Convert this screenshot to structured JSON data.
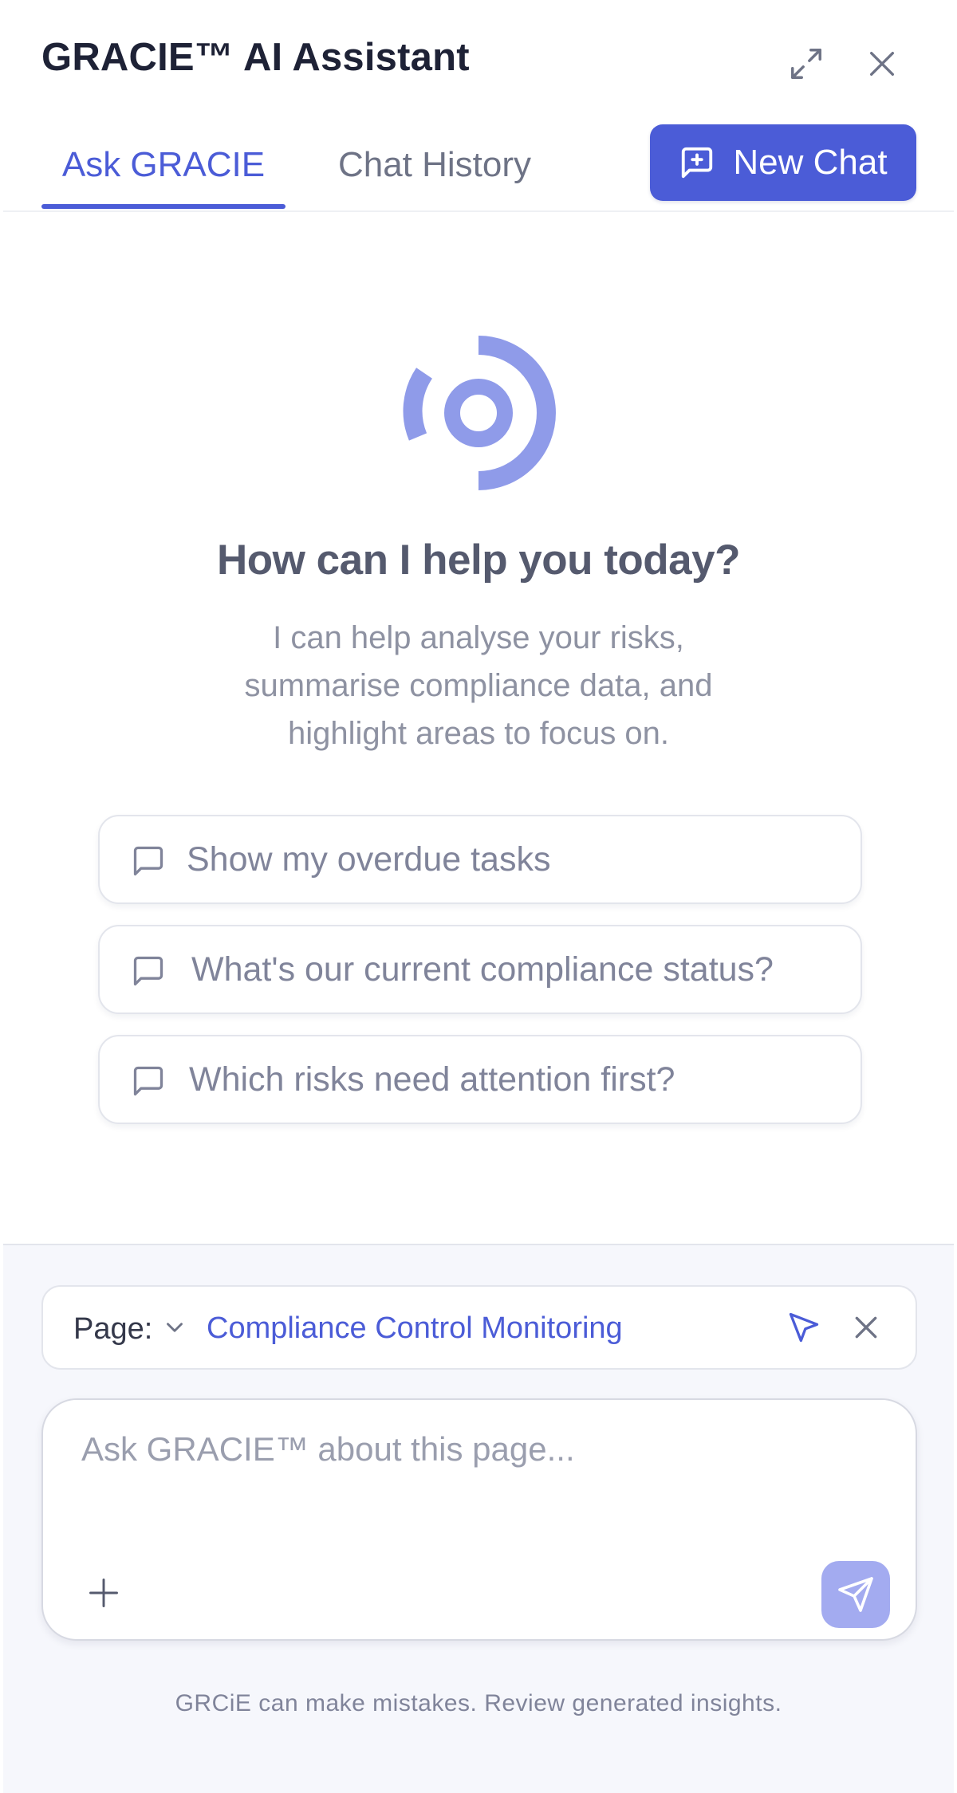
{
  "header": {
    "title": "GRACIE™ AI Assistant",
    "expand_icon": "expand-icon",
    "close_icon": "close-icon"
  },
  "tabs": [
    {
      "label": "Ask GRACIE",
      "active": true
    },
    {
      "label": "Chat History",
      "active": false
    }
  ],
  "new_chat": {
    "label": "New Chat",
    "icon": "message-plus-icon"
  },
  "hero": {
    "logo_icon": "gracie-logo-icon",
    "headline": "How can I help you today?",
    "subtext": "I can help analyse your risks, summarise compliance data, and highlight areas to focus on."
  },
  "suggestions": [
    {
      "label": "Show my overdue tasks",
      "icon": "message-square-icon"
    },
    {
      "label": "What's our current compliance status?",
      "icon": "message-square-icon"
    },
    {
      "label": "Which risks need attention first?",
      "icon": "message-square-icon"
    }
  ],
  "context": {
    "label": "Page:",
    "value": "Compliance Control Monitoring"
  },
  "composer": {
    "placeholder": "Ask GRACIE™ about this page..."
  },
  "disclaimer": "GRCiE can make mistakes. Review generated insights.",
  "colors": {
    "accent": "#4b5cd7",
    "accent_light": "#a3abf0",
    "logo": "#8f9be9",
    "heading": "#555a6e",
    "muted": "#8e92a2",
    "footer_bg": "#f6f7fc"
  }
}
